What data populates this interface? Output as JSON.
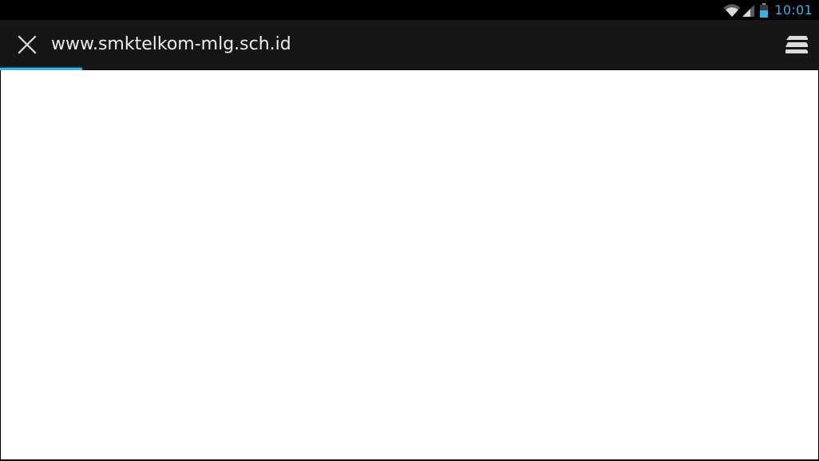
{
  "status_bar": {
    "time": "10:01",
    "icons": [
      "wifi-icon",
      "signal-icon",
      "battery-icon"
    ],
    "accent_color": "#33b5e5"
  },
  "url_bar": {
    "url": "www.smktelkom-mlg.sch.id",
    "close_icon": "close-icon",
    "tabs_icon": "tabs-stack-icon",
    "background_color": "#161616"
  },
  "page_load": {
    "progress": 0.1,
    "color": "#33b5e5"
  },
  "content": {
    "background_color": "#ffffff"
  }
}
